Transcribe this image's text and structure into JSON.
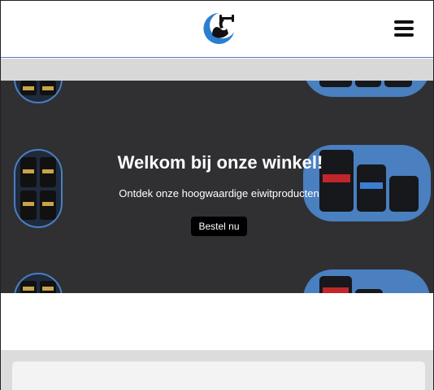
{
  "header": {
    "logo_icon": "flexed-arm-dumbbell-logo",
    "menu_icon": "hamburger-menu-icon"
  },
  "hero": {
    "title": "Welkom bij onze winkel!",
    "subtitle": "Ontdek onze hoogwaardige eiwitproducten",
    "cta_label": "Bestel nu"
  },
  "colors": {
    "hero_background": "#303033",
    "accent_blue": "#4a7fc0",
    "button_background": "#000000"
  }
}
